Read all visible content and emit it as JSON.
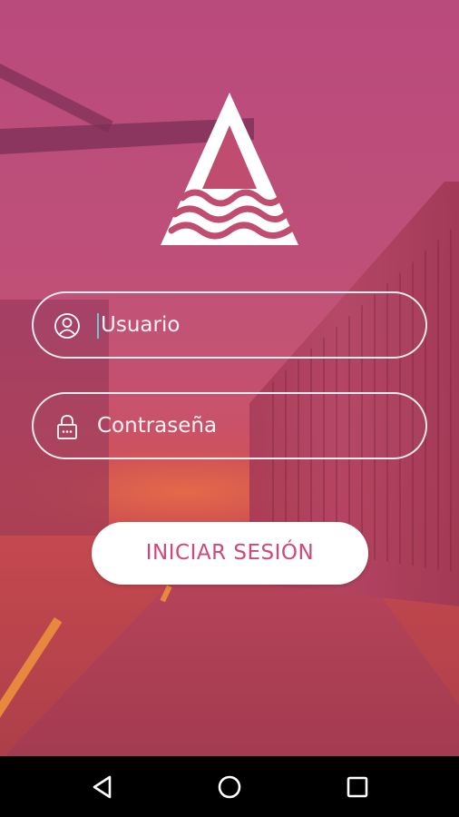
{
  "login": {
    "username_placeholder": "Usuario",
    "password_placeholder": "Contraseña",
    "submit_label": "INICIAR SESIÓN"
  },
  "icons": {
    "logo": "triangle-waves-logo",
    "username": "user-icon",
    "password": "lock-icon",
    "nav_back": "back-triangle-icon",
    "nav_home": "home-circle-icon",
    "nav_recents": "recents-square-icon"
  },
  "colors": {
    "overlay": "#c04c6f",
    "button_text": "#d2467a",
    "button_bg": "#ffffff",
    "field_border": "#ffffff",
    "cursor": "#6fc3d8",
    "navbar": "#000000"
  }
}
